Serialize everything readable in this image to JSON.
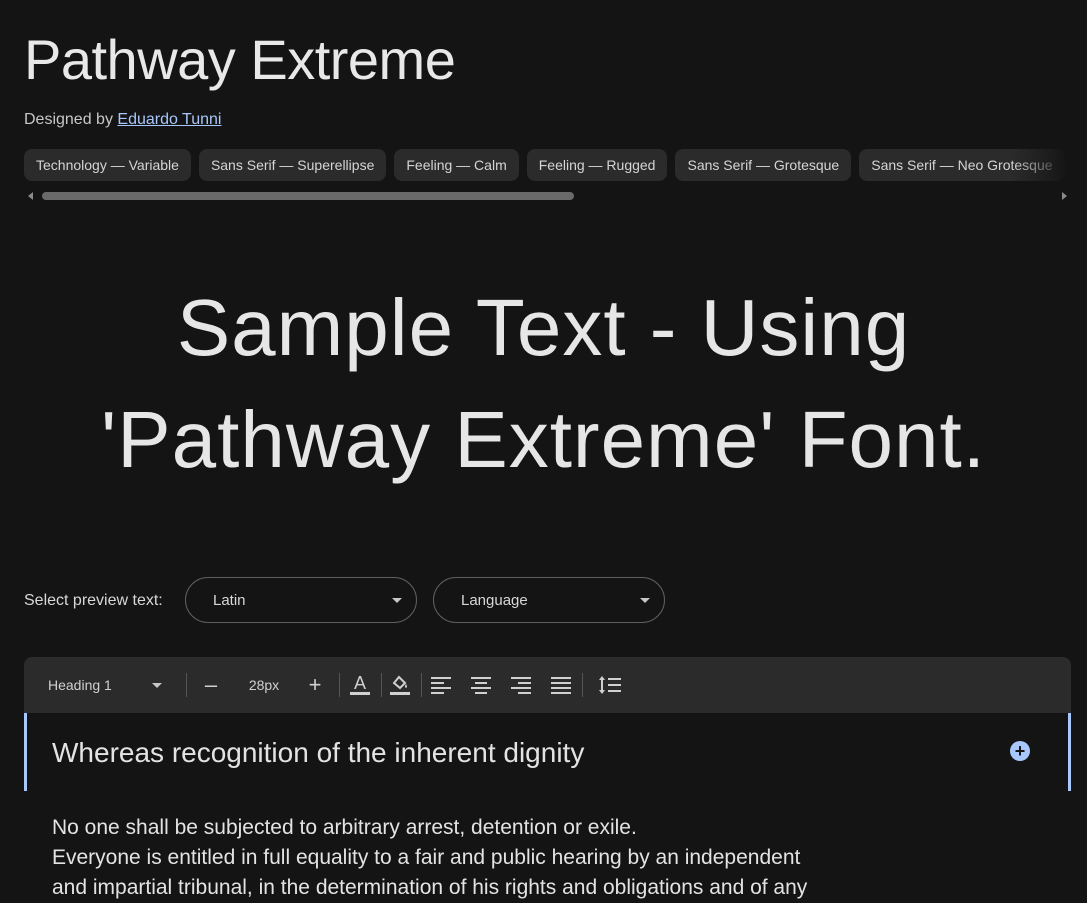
{
  "header": {
    "title": "Pathway Extreme",
    "designed_by_label": "Designed by",
    "designer_name": "Eduardo Tunni"
  },
  "tags": [
    "Technology — Variable",
    "Sans Serif — Superellipse",
    "Feeling — Calm",
    "Feeling — Rugged",
    "Sans Serif — Grotesque",
    "Sans Serif — Neo Grotesque"
  ],
  "sample": {
    "line1": "Sample Text - Using",
    "line2": "'Pathway Extreme' Font."
  },
  "preview": {
    "label": "Select preview text:",
    "script_value": "Latin",
    "language_value": "Language"
  },
  "toolbar": {
    "style_value": "Heading 1",
    "minus": "–",
    "size_value": "28px",
    "plus": "+",
    "icons": [
      "text-color-icon",
      "fill-color-icon",
      "align-left-icon",
      "align-center-icon",
      "align-right-icon",
      "align-justify-icon",
      "line-spacing-icon"
    ]
  },
  "editor": {
    "heading": "Whereas recognition of the inherent dignity",
    "paragraph_lines": [
      "No one shall be subjected to arbitrary arrest, detention or exile.",
      "Everyone is entitled in full equality to a fair and public hearing by an independent",
      "and impartial tribunal, in the determination of his rights and obligations and of any"
    ]
  },
  "colors": {
    "background": "#141414",
    "accent": "#a8c7fa",
    "chip": "#2b2b2b"
  }
}
